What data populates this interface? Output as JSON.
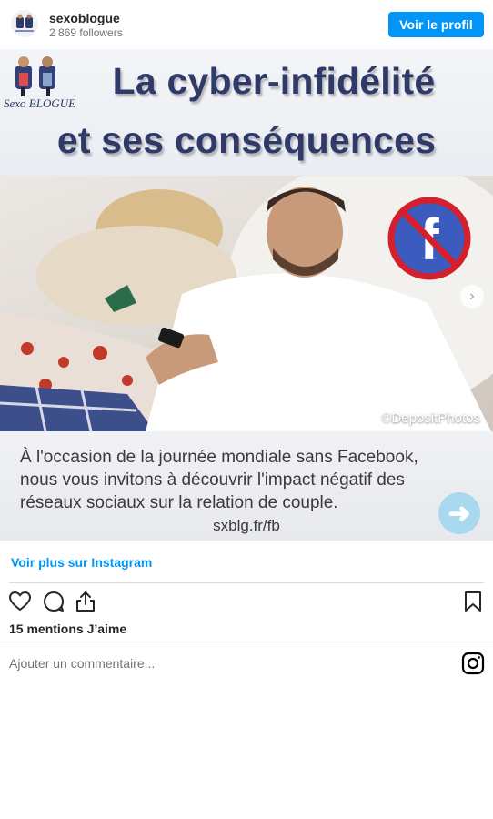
{
  "header": {
    "username": "sexoblogue",
    "followers": "2 869 followers",
    "profile_button": "Voir le profil"
  },
  "post": {
    "title_line1": "La cyber-infidélité",
    "title_line2": "et ses conséquences",
    "logo_text": "Sexo BLOGUE",
    "photo_credit": "©DepositPhotos",
    "caption_line1": "À l'occasion de la journée mondiale sans Facebook,",
    "caption_line2": "nous vous invitons à découvrir l'impact négatif des",
    "caption_line3": "réseaux sociaux sur la relation de couple.",
    "caption_url": "sxblg.fr/fb"
  },
  "footer": {
    "see_more": "Voir plus sur Instagram",
    "likes": "15 mentions J’aime",
    "comment_placeholder": "Ajouter un commentaire..."
  },
  "icons": {
    "like": "heart-icon",
    "comment": "comment-icon",
    "share": "share-icon",
    "save": "bookmark-icon",
    "instagram": "instagram-icon",
    "next": "chevron-right-icon"
  },
  "colors": {
    "accent": "#0095f6",
    "title": "#2f3a69",
    "facebook_blue": "#3b5bbf",
    "ban_red": "#d4202c"
  }
}
